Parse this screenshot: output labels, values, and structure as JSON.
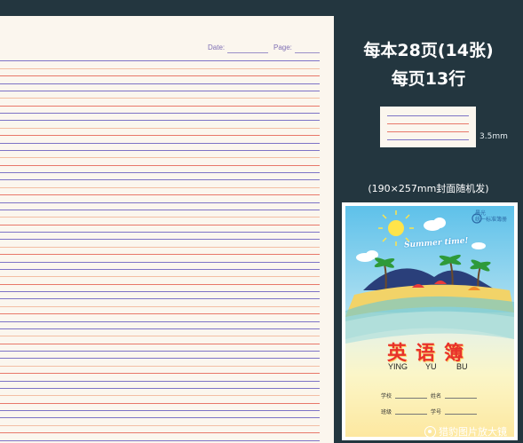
{
  "paper": {
    "date_label": "Date:",
    "page_label": "Page:"
  },
  "info": {
    "line1": "每本28页(14张)",
    "line2": "每页13行",
    "spacing": "3.5mm",
    "size_note": "(190×257mm封面随机发)"
  },
  "cover": {
    "brand_line1": "晨光",
    "brand_line2": "统一标准簿册",
    "summer": "Summer time!",
    "title": "英语簿",
    "pinyin": [
      "YING",
      "YU",
      "BU"
    ],
    "fields": [
      "学校",
      "姓名",
      "班级",
      "学号"
    ]
  },
  "watermark": "猎豹图片放大镜",
  "colors": {
    "background": "#23363f",
    "paper": "#fbf6ee",
    "rule_purple": "#7d73c6",
    "rule_red": "#e8786a",
    "title_red": "#e8322b"
  }
}
